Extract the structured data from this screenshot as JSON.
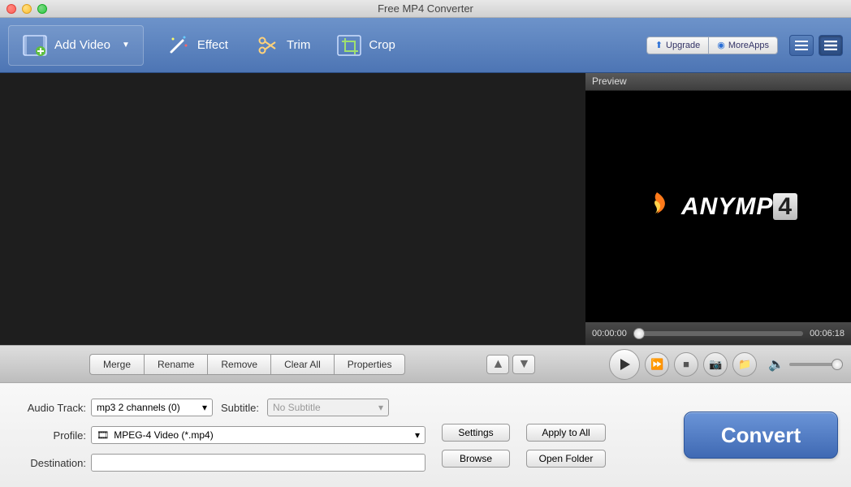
{
  "window": {
    "title": "Free MP4 Converter"
  },
  "toolbar": {
    "add_video": "Add Video",
    "effect": "Effect",
    "trim": "Trim",
    "crop": "Crop",
    "upgrade": "Upgrade",
    "more_apps": "MoreApps"
  },
  "preview": {
    "header": "Preview",
    "logo_text": "ANYMP",
    "logo_suffix": "4",
    "time_current": "00:00:00",
    "time_total": "00:06:18"
  },
  "mid": {
    "merge": "Merge",
    "rename": "Rename",
    "remove": "Remove",
    "clear_all": "Clear All",
    "properties": "Properties"
  },
  "form": {
    "audio_track_label": "Audio Track:",
    "audio_track_value": "mp3 2 channels (0)",
    "subtitle_label": "Subtitle:",
    "subtitle_value": "No Subtitle",
    "profile_label": "Profile:",
    "profile_value": "MPEG-4 Video (*.mp4)",
    "destination_label": "Destination:",
    "destination_value": "",
    "settings": "Settings",
    "apply_all": "Apply to All",
    "browse": "Browse",
    "open_folder": "Open Folder",
    "convert": "Convert"
  }
}
